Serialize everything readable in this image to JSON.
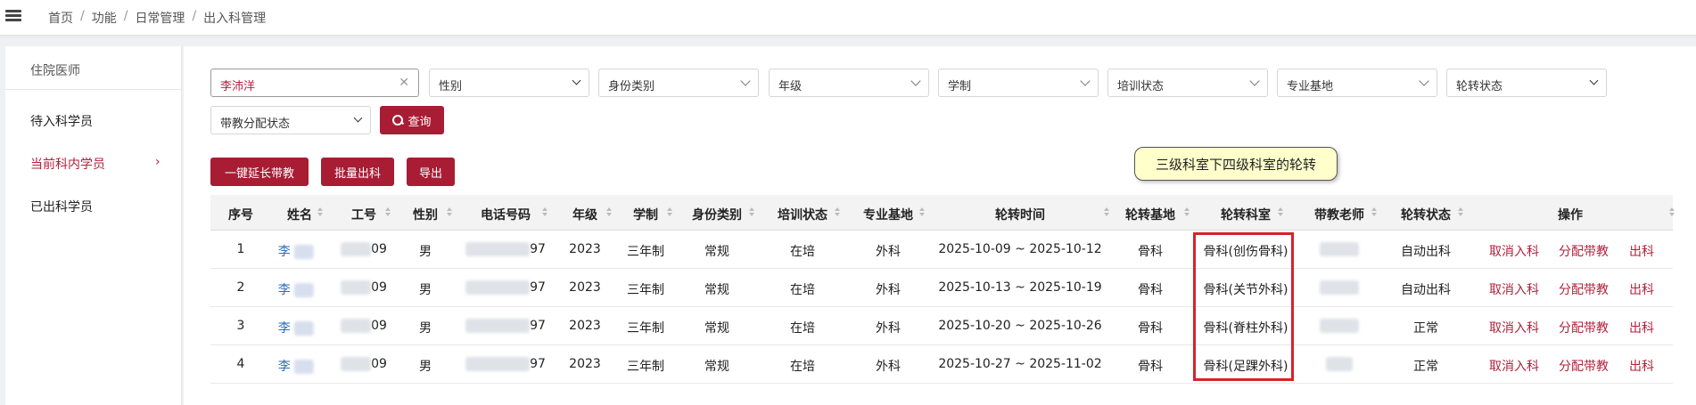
{
  "breadcrumb": [
    "首页",
    "功能",
    "日常管理",
    "出入科管理"
  ],
  "sidebar": {
    "title": "住院医师",
    "items": [
      {
        "label": "待入科学员"
      },
      {
        "label": "当前科内学员",
        "active": true
      },
      {
        "label": "已出科学员"
      }
    ]
  },
  "filters": {
    "name_value": "李沛洋",
    "gender": "性别",
    "identity_type": "身份类别",
    "grade": "年级",
    "study_system": "学制",
    "training_status": "培训状态",
    "base": "专业基地",
    "rotation_status": "轮转状态",
    "teacher_assign_status": "带教分配状态",
    "query_label": "查询"
  },
  "actions": {
    "extend_label": "一键延长带教",
    "batch_out_label": "批量出科",
    "export_label": "导出"
  },
  "annotation": "三级科室下四级科室的轮转",
  "table": {
    "columns": [
      "序号",
      "姓名",
      "工号",
      "性别",
      "电话号码",
      "年级",
      "学制",
      "身份类别",
      "培训状态",
      "专业基地",
      "轮转时间",
      "轮转基地",
      "轮转科室",
      "带教老师",
      "轮转状态",
      "操作"
    ],
    "rows": [
      {
        "no": "1",
        "name": "李",
        "emp_no": "09",
        "gender": "男",
        "phone": "97",
        "grade": "2023",
        "system": "三年制",
        "identity": "常规",
        "training": "在培",
        "base": "外科",
        "period": "2025-10-09 ~ 2025-10-12",
        "rot_base": "骨科",
        "dept": "骨科(创伤骨科)",
        "status": "自动出科"
      },
      {
        "no": "2",
        "name": "李",
        "emp_no": "09",
        "gender": "男",
        "phone": "97",
        "grade": "2023",
        "system": "三年制",
        "identity": "常规",
        "training": "在培",
        "base": "外科",
        "period": "2025-10-13 ~ 2025-10-19",
        "rot_base": "骨科",
        "dept": "骨科(关节外科)",
        "status": "自动出科"
      },
      {
        "no": "3",
        "name": "李",
        "emp_no": "09",
        "gender": "男",
        "phone": "97",
        "grade": "2023",
        "system": "三年制",
        "identity": "常规",
        "training": "在培",
        "base": "外科",
        "period": "2025-10-20 ~ 2025-10-26",
        "rot_base": "骨科",
        "dept": "骨科(脊柱外科)",
        "status": "正常"
      },
      {
        "no": "4",
        "name": "李",
        "emp_no": "09",
        "gender": "男",
        "phone": "97",
        "grade": "2023",
        "system": "三年制",
        "identity": "常规",
        "training": "在培",
        "base": "外科",
        "period": "2025-10-27 ~ 2025-11-02",
        "rot_base": "骨科",
        "dept": "骨科(足踝外科)",
        "status": "正常"
      }
    ],
    "row_actions": [
      "取消入科",
      "分配带教",
      "出科"
    ]
  },
  "colors": {
    "accent": "#a81c34",
    "link": "#2f6cc0",
    "highlight_border": "#d5232a"
  }
}
